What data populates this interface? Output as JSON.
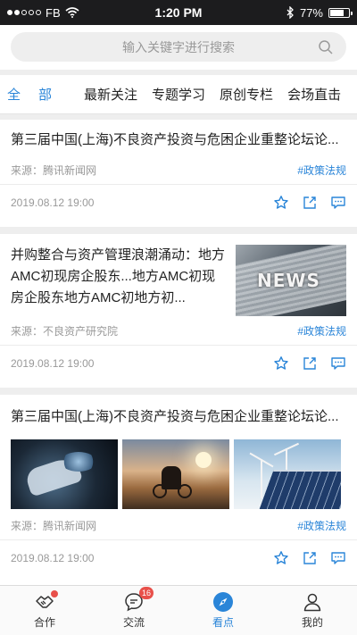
{
  "status_bar": {
    "carrier": "FB",
    "time": "1:20 PM",
    "battery": "77%",
    "battery_level": 0.77
  },
  "search": {
    "placeholder": "输入关键字进行搜索"
  },
  "tabs": [
    {
      "label": "全部"
    },
    {
      "label": "最新关注"
    },
    {
      "label": "专题学习"
    },
    {
      "label": "原创专栏"
    },
    {
      "label": "会场直击"
    }
  ],
  "articles": [
    {
      "title": "第三届中国(上海)不良资产投资与危困企业重整论坛论...",
      "source": "来源：腾讯新闻网",
      "tag": "#政策法规",
      "datetime": "2019.08.12   19:00"
    },
    {
      "title": "并购整合与资产管理浪潮涌动：地方AMC初现房企股东...地方AMC初现房企股东地方AMC初地方初...",
      "thumb_text": "NEWS",
      "source": "来源：不良资产研究院",
      "tag": "#政策法规",
      "datetime": "2019.08.12   19:00"
    },
    {
      "title": "第三届中国(上海)不良资产投资与危困企业重整论坛论...",
      "source": "来源：腾讯新闻网",
      "tag": "#政策法规",
      "datetime": "2019.08.12   19:00"
    }
  ],
  "bottom_nav": [
    {
      "label": "合作",
      "icon": "handshake-icon"
    },
    {
      "label": "交流",
      "icon": "chat-icon",
      "badge": "16"
    },
    {
      "label": "看点",
      "icon": "compass-icon"
    },
    {
      "label": "我的",
      "icon": "person-icon"
    }
  ],
  "colors": {
    "accent": "#2a85d8",
    "badge": "#e8504a",
    "background": "#eeeeee"
  }
}
